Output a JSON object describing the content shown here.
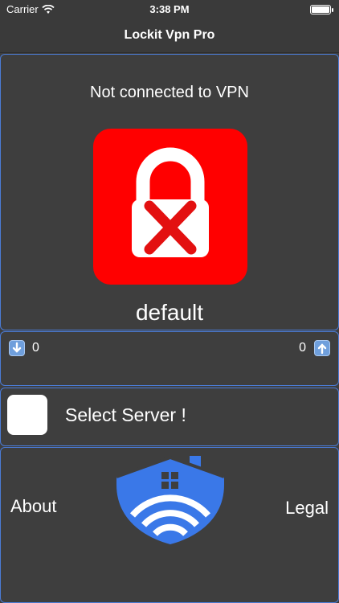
{
  "status_bar": {
    "carrier": "Carrier",
    "time": "3:38 PM"
  },
  "nav": {
    "title": "Lockit Vpn Pro"
  },
  "connection": {
    "status_text": "Not connected to VPN",
    "server_name": "default",
    "lock_color": "#ff0000"
  },
  "traffic": {
    "download": "0",
    "upload": "0"
  },
  "server": {
    "select_label": "Select Server !"
  },
  "footer": {
    "about_label": "About",
    "legal_label": "Legal"
  },
  "colors": {
    "accent": "#4a7bd6",
    "logo_blue": "#3a78e8",
    "background": "#3e3e3e"
  }
}
